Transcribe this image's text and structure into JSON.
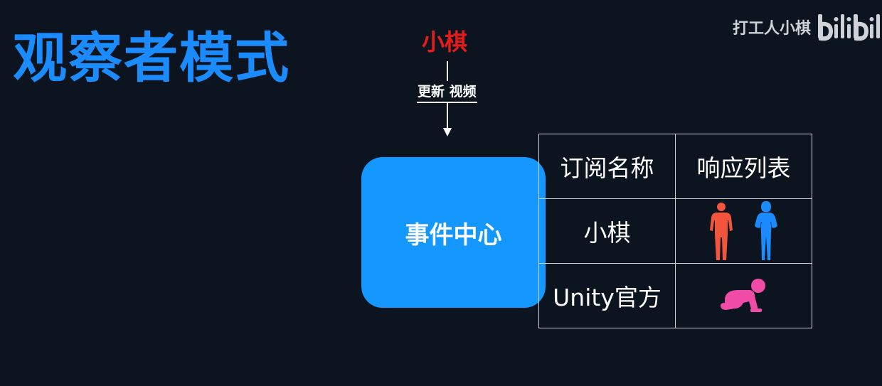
{
  "slide": {
    "title": "观察者模式",
    "publisher": "小棋",
    "arrow_label": "更新 视频",
    "event_center_label": "事件中心"
  },
  "watermark": {
    "text": "打工人小棋",
    "logo_text": "bilibili"
  },
  "table": {
    "headers": [
      "订阅名称",
      "响应列表"
    ],
    "rows": [
      {
        "name": "小棋",
        "responders": [
          "man-silhouette-icon",
          "woman-silhouette-icon"
        ]
      },
      {
        "name": "Unity官方",
        "responders": [
          "crawling-baby-icon"
        ]
      }
    ]
  },
  "colors": {
    "background": "#0c151f",
    "title": "#1a8cff",
    "publisher": "#e81b1b",
    "event_center": "#1497ff",
    "man_icon": "#f2543c",
    "woman_icon": "#1a8cff",
    "baby_icon": "#f04ba6"
  }
}
